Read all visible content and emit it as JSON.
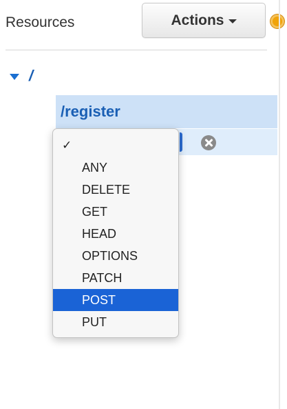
{
  "header": {
    "title": "Resources",
    "actions_label": "Actions"
  },
  "tree": {
    "root_label": "/",
    "resource_label": "/register"
  },
  "method_dropdown": {
    "checked_item": "✓",
    "options": [
      "ANY",
      "DELETE",
      "GET",
      "HEAD",
      "OPTIONS",
      "PATCH",
      "POST",
      "PUT"
    ],
    "highlighted": "POST"
  },
  "colors": {
    "accent": "#1a63d6",
    "link": "#1a5fb4",
    "row_selected": "#cde1f7",
    "status": "#f0a30a"
  },
  "icons": [
    "caret-down-icon",
    "status-dot-icon",
    "expand-triangle-icon",
    "checkmark-icon",
    "remove-icon"
  ]
}
